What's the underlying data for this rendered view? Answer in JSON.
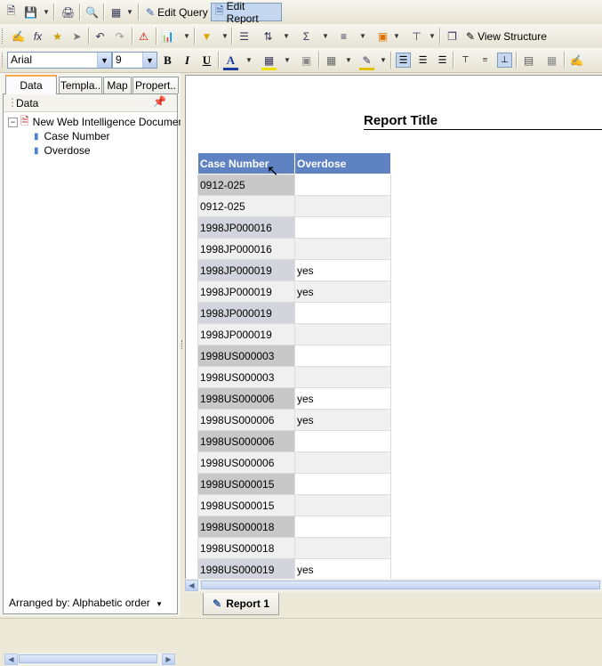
{
  "toolbar1": {
    "edit_query_label": "Edit Query",
    "edit_report_label": "Edit Report",
    "icons": [
      "new-document-icon",
      "save-icon",
      "print-icon",
      "find-icon",
      "view-icon"
    ]
  },
  "toolbar2": {
    "view_structure_label": "View Structure"
  },
  "format_toolbar": {
    "font_name": "Arial",
    "font_size": "9",
    "bold": "B",
    "italic": "I",
    "underline": "U",
    "font_color_glyph": "A",
    "colors": {
      "accent": "#c5d7ef",
      "header_bg": "#5f82c3"
    }
  },
  "left_panel": {
    "tabs": [
      "Data",
      "Templa..",
      "Map",
      "Propert.."
    ],
    "active_tab": "Data",
    "section_header": "Data",
    "tree": {
      "root": "New Web Intelligence Document",
      "children": [
        "Case Number",
        "Overdose"
      ]
    },
    "arranged_by": "Arranged by: Alphabetic order"
  },
  "report": {
    "title": "Report Title",
    "columns": [
      "Case Number",
      "Overdose"
    ],
    "rows": [
      [
        "0912-025",
        ""
      ],
      [
        "0912-025",
        ""
      ],
      [
        "1998JP000016",
        ""
      ],
      [
        "1998JP000016",
        ""
      ],
      [
        "1998JP000019",
        "yes"
      ],
      [
        "1998JP000019",
        "yes"
      ],
      [
        "1998JP000019",
        ""
      ],
      [
        "1998JP000019",
        ""
      ],
      [
        "1998US000003",
        ""
      ],
      [
        "1998US000003",
        ""
      ],
      [
        "1998US000006",
        "yes"
      ],
      [
        "1998US000006",
        "yes"
      ],
      [
        "1998US000006",
        ""
      ],
      [
        "1998US000006",
        ""
      ],
      [
        "1998US000015",
        ""
      ],
      [
        "1998US000015",
        ""
      ],
      [
        "1998US000018",
        ""
      ],
      [
        "1998US000018",
        ""
      ],
      [
        "1998US000019",
        "yes"
      ]
    ],
    "tab_label": "Report 1"
  }
}
